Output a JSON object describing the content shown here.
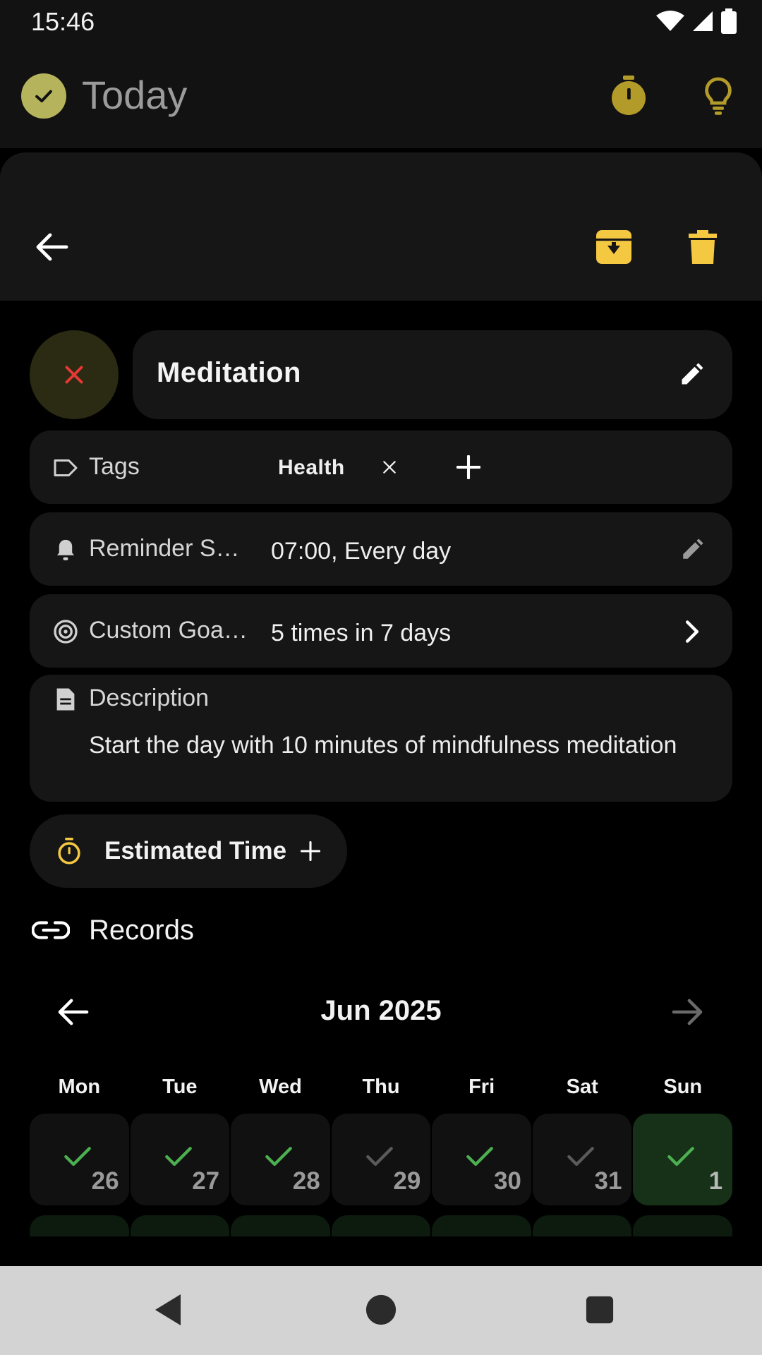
{
  "status_bar": {
    "time": "15:46"
  },
  "app_bar": {
    "title": "Today"
  },
  "habit": {
    "name": "Meditation",
    "tags_label": "Tags",
    "tag": "Health",
    "reminder_label": "Reminder S…",
    "reminder_value": "07:00, Every day",
    "goal_label": "Custom Goa…",
    "goal_value": "5 times in 7 days",
    "description_label": "Description",
    "description_text": "Start the day with 10 minutes of mindfulness meditation",
    "estimated_time_label": "Estimated Time"
  },
  "records": {
    "title": "Records",
    "month": "Jun 2025",
    "weekdays": [
      "Mon",
      "Tue",
      "Wed",
      "Thu",
      "Fri",
      "Sat",
      "Sun"
    ],
    "days": [
      {
        "day": "26",
        "completed": true
      },
      {
        "day": "27",
        "completed": true
      },
      {
        "day": "28",
        "completed": true
      },
      {
        "day": "29",
        "completed": false
      },
      {
        "day": "30",
        "completed": true
      },
      {
        "day": "31",
        "completed": false
      },
      {
        "day": "1",
        "completed": true
      }
    ]
  },
  "colors": {
    "accent_yellow": "#f5c841",
    "check_green": "#4caf50",
    "cancel_red": "#e53935",
    "logo_olive": "#b5b45c"
  }
}
